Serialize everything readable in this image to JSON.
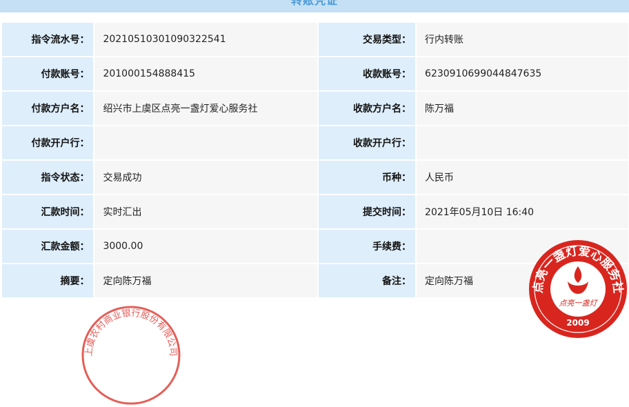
{
  "title": "转账凭证",
  "rows": [
    {
      "l1": "指令流水号：",
      "v1": "20210510301090322541",
      "l2": "交易类型：",
      "v2": "行内转账"
    },
    {
      "l1": "付款账号：",
      "v1": "201000154888415",
      "l2": "收款账号：",
      "v2": "6230910699044847635"
    },
    {
      "l1": "付款方户名：",
      "v1": "绍兴市上虞区点亮一盏灯爱心服务社",
      "l2": "收款方户名：",
      "v2": "陈万福"
    },
    {
      "l1": "付款开户行：",
      "v1": "",
      "l2": "收款开户行：",
      "v2": ""
    },
    {
      "l1": "指令状态：",
      "v1": "交易成功",
      "l2": "币种：",
      "v2": "人民币"
    },
    {
      "l1": "汇款时间：",
      "v1": "实时汇出",
      "l2": "提交时间：",
      "v2": "2021年05月10日 16:40"
    },
    {
      "l1": "汇款金额：",
      "v1": "3000.00",
      "l2": "手续费：",
      "v2": ""
    },
    {
      "l1": "摘要：",
      "v1": "定向陈万福",
      "l2": "备注：",
      "v2": "定向陈万福"
    }
  ],
  "stamps": {
    "left_text": "上虞农村商业银行股份有限公司",
    "right_ring_text": "点亮一盏灯爱心服务社",
    "right_inner_text": "点亮一盏灯",
    "right_year": "2009"
  },
  "colors": {
    "title_bg": "#c5e0f5",
    "title_text": "#4a9ad6",
    "label_bg": "#deeefb",
    "value_bg": "#f6f6f6",
    "stamp_red": "#d8261f"
  }
}
